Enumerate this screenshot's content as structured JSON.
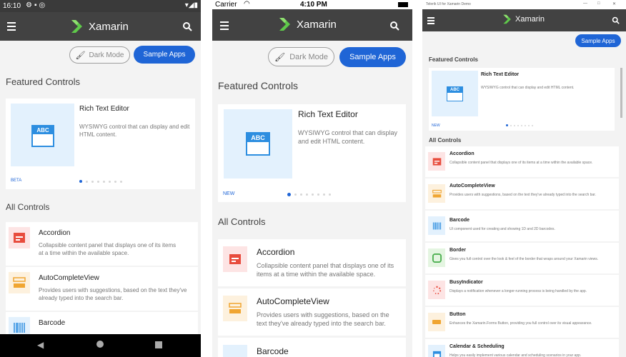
{
  "app": {
    "brand": "Xamarin",
    "dark_mode": "Dark Mode",
    "sample_apps": "Sample Apps",
    "featured": "Featured Controls",
    "all": "All Controls"
  },
  "android": {
    "time": "16:10",
    "featured_title": "Rich Text Editor",
    "featured_desc": "WYSIWYG control that can display and edit HTML content.",
    "tag": "BETA",
    "thumb_text": "ABC"
  },
  "ios": {
    "carrier": "Carrier",
    "time": "4:10 PM",
    "featured_title": "Rich Text Editor",
    "featured_desc": "WYSIWYG control that can display and edit HTML content.",
    "tag": "NEW",
    "thumb_text": "ABC"
  },
  "win": {
    "window_title": "Telerik UI for Xamarin Demo",
    "featured_title": "Rich Text Editor",
    "featured_desc": "WYSIWYG control that can display and edit HTML content.",
    "tag": "NEW",
    "thumb_text": "ABC"
  },
  "controls": [
    {
      "name": "Accordion",
      "desc": "Collapsible content panel that displays one of its items at a time within the available space."
    },
    {
      "name": "AutoCompleteView",
      "desc": "Provides users with suggestions, based on the text they've already typed into the search bar."
    },
    {
      "name": "Barcode",
      "desc": "UI component used for creating and showing 1D and 2D barcodes."
    },
    {
      "name": "Border",
      "desc": "Gives you full control over the look & feel of the border that wraps around your Xamarin views."
    },
    {
      "name": "BusyIndicator",
      "desc": "Displays a notification whenever a longer-running process is being handled by the app."
    },
    {
      "name": "Button",
      "desc": "Enhances the Xamarin.Forms Button, providing you full control over its visual appearance."
    },
    {
      "name": "Calendar & Scheduling",
      "desc": "Helps you easily implement various calendar and scheduling scenarios in your app."
    }
  ],
  "colors": {
    "header": "#424242",
    "accent": "#1f65d6",
    "thumb_bg": "#e3f1fd",
    "icon_blue": "#2d8ee0"
  }
}
